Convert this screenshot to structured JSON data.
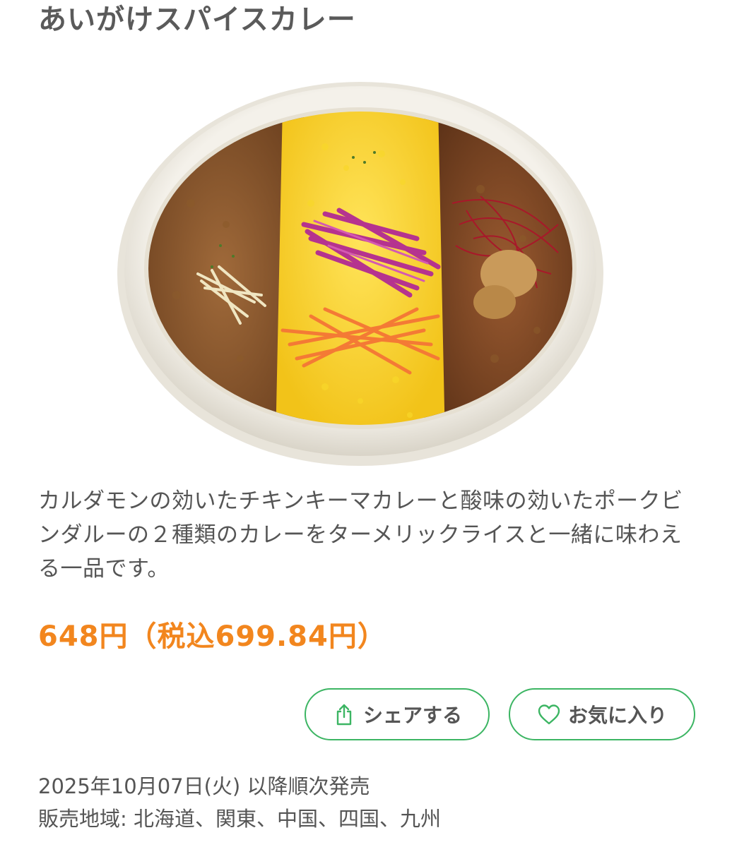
{
  "product": {
    "title": "あいがけスパイスカレー",
    "image_alt": "あいがけスパイスカレー",
    "description": "カルダモンの効いたチキンキーマカレーと酸味の効いたポークビンダルーの２種類のカレーをターメリックライスと一緒に味わえる一品です。",
    "price": "648円（税込699.84円）"
  },
  "actions": {
    "share_label": "シェアする",
    "favorite_label": "お気に入り"
  },
  "icons": {
    "share": "share-icon",
    "favorite": "heart-icon"
  },
  "info": {
    "release": "2025年10月07日(火) 以降順次発売",
    "region": "販売地域: 北海道、関東、中国、四国、九州"
  },
  "colors": {
    "accent_green": "#3cb563",
    "price_orange": "#f2861e",
    "text_gray": "#555555"
  }
}
